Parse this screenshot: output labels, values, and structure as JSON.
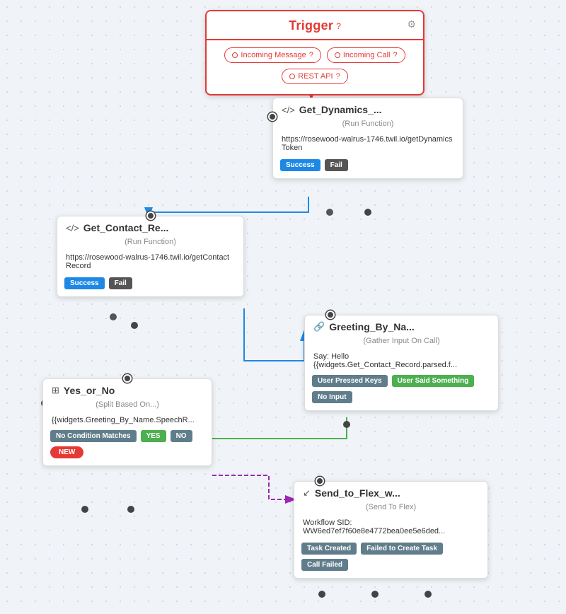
{
  "trigger": {
    "title": "Trigger",
    "help": "?",
    "buttons": [
      {
        "label": "Incoming Message",
        "help": "?"
      },
      {
        "label": "Incoming Call",
        "help": "?"
      },
      {
        "label": "REST API",
        "help": "?"
      }
    ]
  },
  "getDynamics": {
    "icon": "</>",
    "title": "Get_Dynamics_...",
    "subtitle": "(Run Function)",
    "url": "https://rosewood-walrus-1746.twil.io/getDynamicsToken",
    "badges": [
      {
        "label": "Success",
        "type": "success"
      },
      {
        "label": "Fail",
        "type": "fail"
      }
    ]
  },
  "getContact": {
    "icon": "</>",
    "title": "Get_Contact_Re...",
    "subtitle": "(Run Function)",
    "url": "https://rosewood-walrus-1746.twil.io/getContactRecord",
    "badges": [
      {
        "label": "Success",
        "type": "success"
      },
      {
        "label": "Fail",
        "type": "fail"
      }
    ]
  },
  "greeting": {
    "icon": "🔗",
    "title": "Greeting_By_Na...",
    "subtitle": "(Gather Input On Call)",
    "say": "Say: Hello",
    "template": "{{widgets.Get_Contact_Record.parsed.f...",
    "badges": [
      {
        "label": "User Pressed Keys",
        "type": "keys"
      },
      {
        "label": "User Said Something",
        "type": "said"
      },
      {
        "label": "No Input",
        "type": "noinput"
      }
    ]
  },
  "yesno": {
    "icon": "⊞",
    "title": "Yes_or_No",
    "subtitle": "(Split Based On...)",
    "value": "{{widgets.Greeting_By_Name.SpeechR...",
    "badges": [
      {
        "label": "No Condition Matches",
        "type": "nocond"
      },
      {
        "label": "YES",
        "type": "yes"
      },
      {
        "label": "NO",
        "type": "no"
      },
      {
        "label": "NEW",
        "type": "new"
      }
    ]
  },
  "sendFlex": {
    "icon": "↙",
    "title": "Send_to_Flex_w...",
    "subtitle": "(Send To Flex)",
    "workflowLabel": "Workflow SID:",
    "workflowValue": "WW6ed7ef7f60e8e4772bea0ee5e6ded...",
    "badges": [
      {
        "label": "Task Created",
        "type": "created"
      },
      {
        "label": "Failed to Create Task",
        "type": "failcreate"
      },
      {
        "label": "Call Failed",
        "type": "callfail"
      }
    ]
  }
}
